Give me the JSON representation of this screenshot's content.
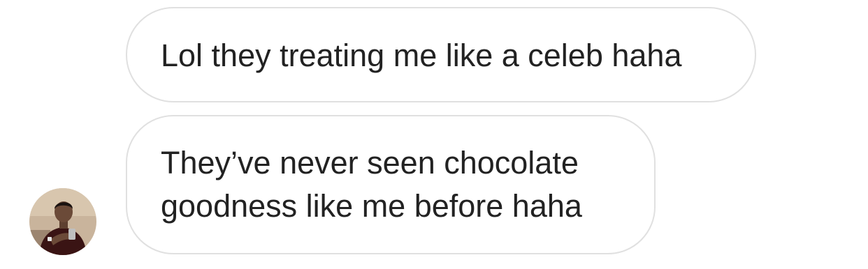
{
  "messages": [
    {
      "text": "Lol they treating me like a celeb haha"
    },
    {
      "lines": [
        "They’ve never seen chocolate",
        "goodness like me before haha"
      ]
    }
  ],
  "avatar": {
    "icon": "user-photo-avatar",
    "colors": {
      "background": "#c9b49c",
      "shirt": "#3a1414",
      "skin": "#6b4a38",
      "hair": "#1a1210"
    }
  },
  "bubble_colors": {
    "border": "#e0e0e0",
    "text": "#222222",
    "background": "#ffffff"
  }
}
